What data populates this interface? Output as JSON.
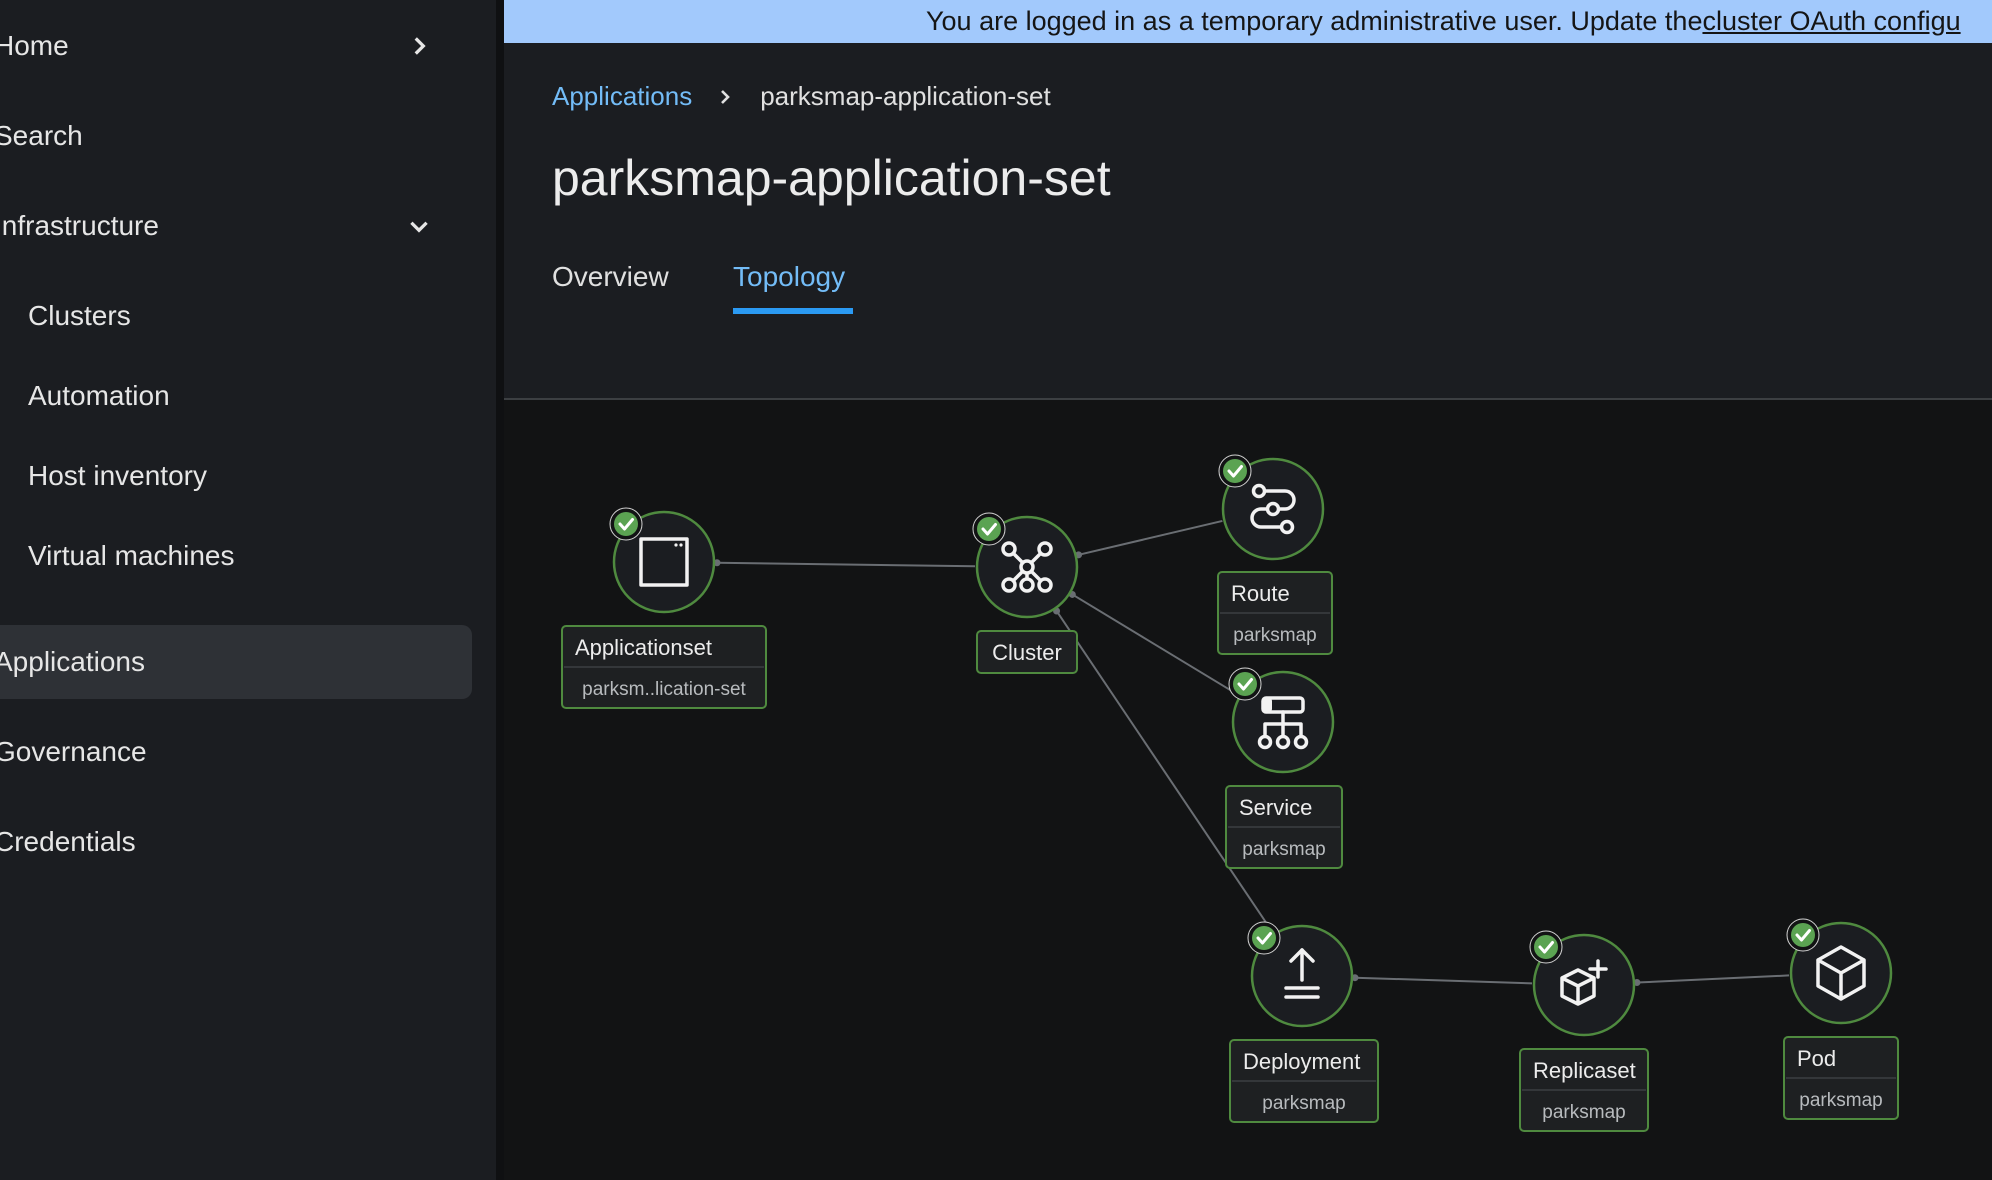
{
  "sidebar": {
    "items": [
      {
        "label": "Home",
        "chevron": "chevron-right"
      },
      {
        "label": "Search"
      },
      {
        "label": "Infrastructure",
        "chevron": "chevron-down"
      },
      {
        "label": "Clusters"
      },
      {
        "label": "Automation"
      },
      {
        "label": "Host inventory"
      },
      {
        "label": "Virtual machines"
      },
      {
        "label": "Applications",
        "active": true
      },
      {
        "label": "Governance"
      },
      {
        "label": "Credentials"
      }
    ]
  },
  "banner": {
    "text": "You are logged in as a temporary administrative user. Update the ",
    "link": "cluster OAuth configu"
  },
  "breadcrumb": {
    "parent": "Applications",
    "current": "parksmap-application-set"
  },
  "page": {
    "title": "parksmap-application-set"
  },
  "tabs": [
    {
      "label": "Overview"
    },
    {
      "label": "Topology",
      "active": true
    }
  ],
  "topology": {
    "nodes": [
      {
        "id": "appset",
        "title": "Applicationset",
        "subtitle": "parksm..lication-set",
        "icon": "applicationset-icon",
        "status": "ok"
      },
      {
        "id": "cluster",
        "title": "Cluster",
        "subtitle": "",
        "icon": "cluster-icon",
        "status": "ok"
      },
      {
        "id": "route",
        "title": "Route",
        "subtitle": "parksmap",
        "icon": "route-icon",
        "status": "ok"
      },
      {
        "id": "service",
        "title": "Service",
        "subtitle": "parksmap",
        "icon": "service-icon",
        "status": "ok"
      },
      {
        "id": "deployment",
        "title": "Deployment",
        "subtitle": "parksmap",
        "icon": "deployment-icon",
        "status": "ok"
      },
      {
        "id": "replicaset",
        "title": "Replicaset",
        "subtitle": "parksmap",
        "icon": "replicaset-icon",
        "status": "ok"
      },
      {
        "id": "pod",
        "title": "Pod",
        "subtitle": "parksmap",
        "icon": "pod-icon",
        "status": "ok"
      }
    ],
    "edges": [
      [
        "appset",
        "cluster"
      ],
      [
        "cluster",
        "route"
      ],
      [
        "cluster",
        "service"
      ],
      [
        "cluster",
        "deployment"
      ],
      [
        "deployment",
        "replicaset"
      ],
      [
        "replicaset",
        "pod"
      ]
    ],
    "colors": {
      "node_border": "#4f8a3f",
      "status_ok": "#5ba352",
      "edge": "#6a6e73"
    }
  }
}
